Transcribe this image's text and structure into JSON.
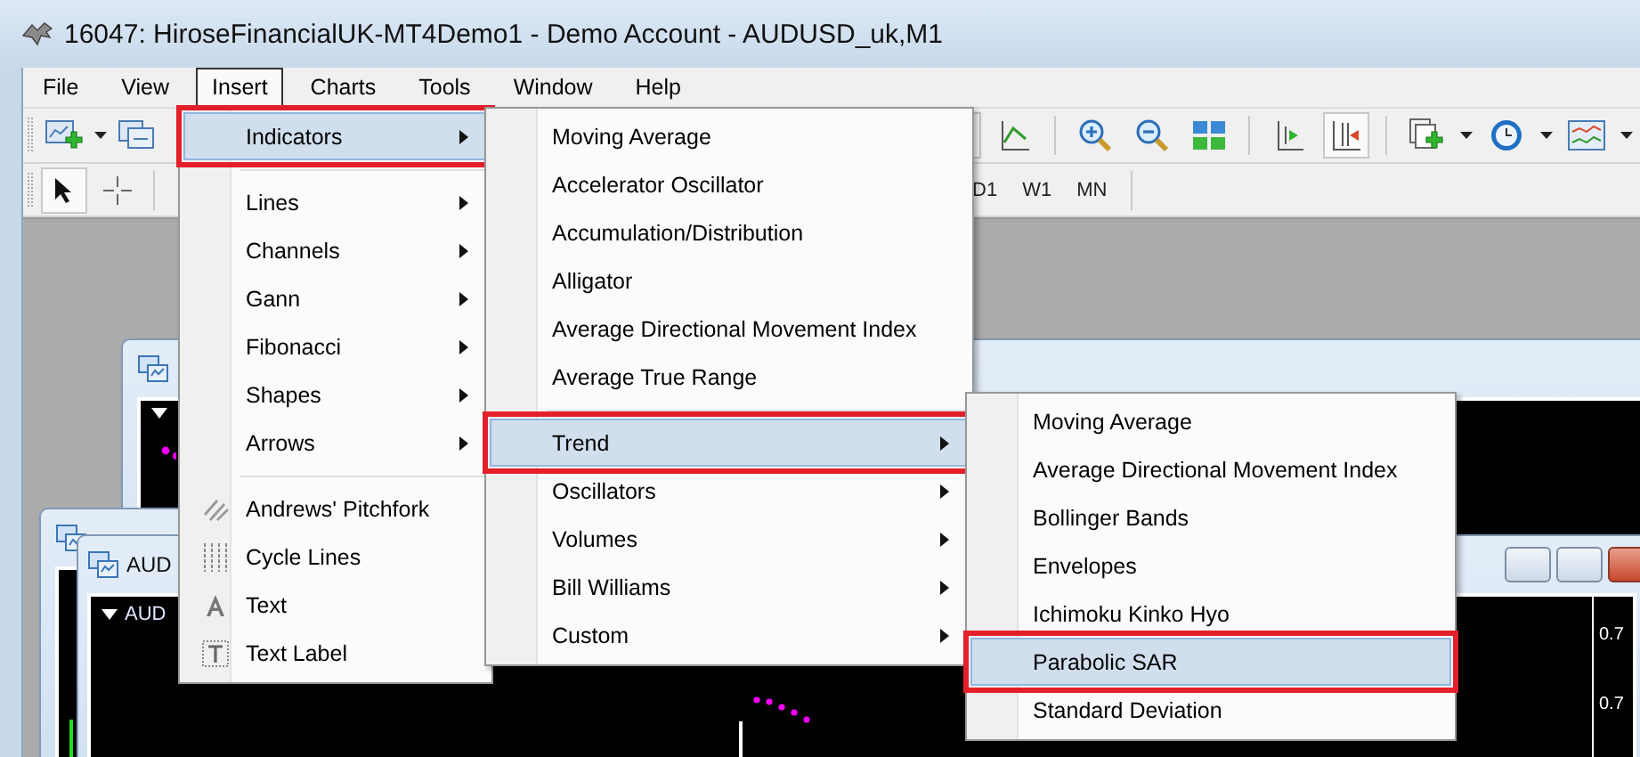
{
  "window": {
    "title": "16047: HiroseFinancialUK-MT4Demo1 - Demo Account - AUDUSD_uk,M1"
  },
  "menu_bar": [
    {
      "label": "File",
      "selected": false
    },
    {
      "label": "View",
      "selected": false
    },
    {
      "label": "Insert",
      "selected": true
    },
    {
      "label": "Charts",
      "selected": false
    },
    {
      "label": "Tools",
      "selected": false
    },
    {
      "label": "Window",
      "selected": false
    },
    {
      "label": "Help",
      "selected": false
    }
  ],
  "timeframes": [
    "D1",
    "W1",
    "MN"
  ],
  "chart_windows": [
    {
      "title": "AUD",
      "label": "AUD",
      "price_labels": [
        "0.7",
        "0.7"
      ]
    }
  ],
  "insert_menu": [
    {
      "kind": "item",
      "label": "Indicators",
      "submenu": true,
      "selected": true,
      "marked": true
    },
    {
      "kind": "separator"
    },
    {
      "kind": "item",
      "label": "Lines",
      "submenu": true,
      "selected": false,
      "marked": false
    },
    {
      "kind": "item",
      "label": "Channels",
      "submenu": true,
      "selected": false,
      "marked": false
    },
    {
      "kind": "item",
      "label": "Gann",
      "submenu": true,
      "selected": false,
      "marked": false
    },
    {
      "kind": "item",
      "label": "Fibonacci",
      "submenu": true,
      "selected": false,
      "marked": false
    },
    {
      "kind": "item",
      "label": "Shapes",
      "submenu": true,
      "selected": false,
      "marked": false
    },
    {
      "kind": "item",
      "label": "Arrows",
      "submenu": true,
      "selected": false,
      "marked": false
    },
    {
      "kind": "separator"
    },
    {
      "kind": "tool",
      "label": "Andrews' Pitchfork",
      "submenu": false,
      "selected": false,
      "marked": false
    },
    {
      "kind": "tool",
      "label": "Cycle Lines",
      "submenu": false,
      "selected": false,
      "marked": false
    },
    {
      "kind": "tool",
      "label": "Text",
      "submenu": false,
      "selected": false,
      "marked": false
    },
    {
      "kind": "tool",
      "label": "Text Label",
      "submenu": false,
      "selected": false,
      "marked": false
    }
  ],
  "indicators_menu": [
    {
      "kind": "item",
      "label": "Moving Average",
      "submenu": false,
      "selected": false,
      "marked": false
    },
    {
      "kind": "item",
      "label": "Accelerator Oscillator",
      "submenu": false,
      "selected": false,
      "marked": false
    },
    {
      "kind": "item",
      "label": "Accumulation/Distribution",
      "submenu": false,
      "selected": false,
      "marked": false
    },
    {
      "kind": "item",
      "label": "Alligator",
      "submenu": false,
      "selected": false,
      "marked": false
    },
    {
      "kind": "item",
      "label": "Average Directional Movement Index",
      "submenu": false,
      "selected": false,
      "marked": false
    },
    {
      "kind": "item",
      "label": "Average True Range",
      "submenu": false,
      "selected": false,
      "marked": false
    },
    {
      "kind": "separator"
    },
    {
      "kind": "item",
      "label": "Trend",
      "submenu": true,
      "selected": true,
      "marked": true
    },
    {
      "kind": "item",
      "label": "Oscillators",
      "submenu": true,
      "selected": false,
      "marked": false
    },
    {
      "kind": "item",
      "label": "Volumes",
      "submenu": true,
      "selected": false,
      "marked": false
    },
    {
      "kind": "item",
      "label": "Bill Williams",
      "submenu": true,
      "selected": false,
      "marked": false
    },
    {
      "kind": "item",
      "label": "Custom",
      "submenu": true,
      "selected": false,
      "marked": false
    }
  ],
  "trend_menu": [
    {
      "kind": "item",
      "label": "Moving Average",
      "submenu": false,
      "selected": false,
      "marked": false
    },
    {
      "kind": "item",
      "label": "Average Directional Movement Index",
      "submenu": false,
      "selected": false,
      "marked": false
    },
    {
      "kind": "item",
      "label": "Bollinger Bands",
      "submenu": false,
      "selected": false,
      "marked": false
    },
    {
      "kind": "item",
      "label": "Envelopes",
      "submenu": false,
      "selected": false,
      "marked": false
    },
    {
      "kind": "item",
      "label": "Ichimoku Kinko Hyo",
      "submenu": false,
      "selected": false,
      "marked": false
    },
    {
      "kind": "item",
      "label": "Parabolic SAR",
      "submenu": false,
      "selected": true,
      "marked": true
    },
    {
      "kind": "item",
      "label": "Standard Deviation",
      "submenu": false,
      "selected": false,
      "marked": false
    }
  ]
}
